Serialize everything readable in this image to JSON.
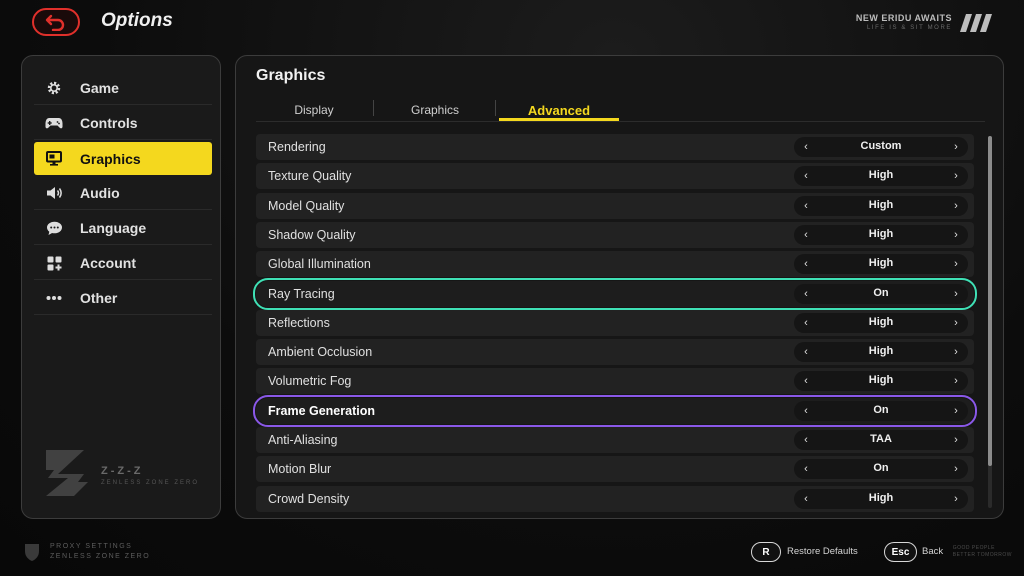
{
  "header": {
    "title": "Options",
    "brand_title": "NEW ERIDU AWAITS",
    "brand_sub": "LIFE IS & SIT MORE"
  },
  "sidebar": {
    "items": [
      {
        "label": "Game",
        "icon": "gear-icon"
      },
      {
        "label": "Controls",
        "icon": "gamepad-icon"
      },
      {
        "label": "Graphics",
        "icon": "monitor-icon",
        "active": true
      },
      {
        "label": "Audio",
        "icon": "speaker-icon"
      },
      {
        "label": "Language",
        "icon": "chat-bubble-icon"
      },
      {
        "label": "Account",
        "icon": "grid-icon"
      },
      {
        "label": "Other",
        "icon": "dots-icon"
      }
    ],
    "logo_text": "Z-Z-Z",
    "logo_sub": "ZENLESS ZONE ZERO"
  },
  "panel": {
    "title": "Graphics",
    "tabs": [
      {
        "label": "Display"
      },
      {
        "label": "Graphics"
      },
      {
        "label": "Advanced",
        "active": true
      }
    ],
    "settings": [
      {
        "label": "Rendering",
        "value": "Custom"
      },
      {
        "label": "Texture Quality",
        "value": "High"
      },
      {
        "label": "Model Quality",
        "value": "High"
      },
      {
        "label": "Shadow Quality",
        "value": "High"
      },
      {
        "label": "Global Illumination",
        "value": "High"
      },
      {
        "label": "Ray Tracing",
        "value": "On",
        "highlight": "teal"
      },
      {
        "label": "Reflections",
        "value": "High"
      },
      {
        "label": "Ambient Occlusion",
        "value": "High"
      },
      {
        "label": "Volumetric Fog",
        "value": "High"
      },
      {
        "label": "Frame Generation",
        "value": "On",
        "highlight": "purple"
      },
      {
        "label": "Anti-Aliasing",
        "value": "TAA"
      },
      {
        "label": "Motion Blur",
        "value": "On"
      },
      {
        "label": "Crowd Density",
        "value": "High"
      }
    ]
  },
  "footer": {
    "brand_line1": "PROXY SETTINGS",
    "brand_line2": "ZENLESS ZONE ZERO",
    "restore_key": "R",
    "restore_label": "Restore Defaults",
    "back_key": "Esc",
    "back_label": "Back",
    "mark_line1": "GOOD PEOPLE",
    "mark_line2": "BETTER TOMORROW"
  },
  "colors": {
    "accent_yellow": "#f4d81e",
    "highlight_teal": "#3fe0b5",
    "highlight_purple": "#8a58e8",
    "back_red": "#e0302b"
  }
}
